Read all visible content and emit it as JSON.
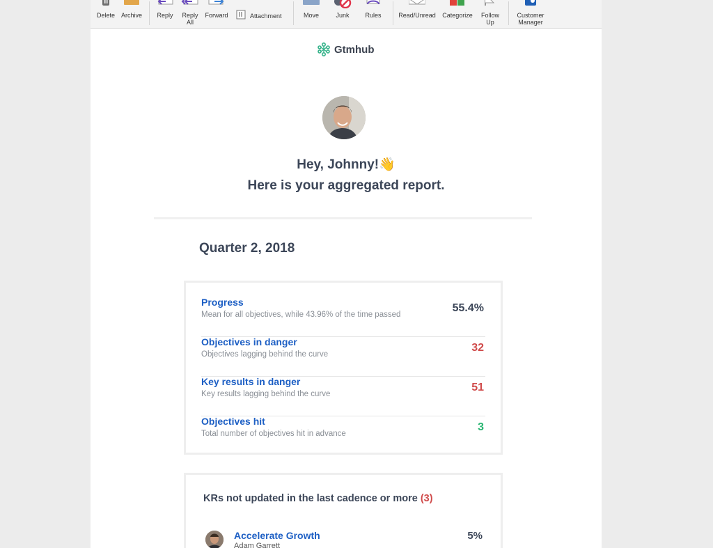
{
  "toolbar": {
    "buttons": [
      {
        "label": "Delete"
      },
      {
        "label": "Archive"
      },
      {
        "label": "Reply"
      },
      {
        "label": "Reply All"
      },
      {
        "label": "Forward"
      },
      {
        "label": "Attachment"
      },
      {
        "label": "Move"
      },
      {
        "label": "Junk"
      },
      {
        "label": "Rules"
      },
      {
        "label": "Read/Unread"
      },
      {
        "label": "Categorize"
      },
      {
        "label": "Follow Up"
      },
      {
        "label": "Customer Manager"
      }
    ]
  },
  "email": {
    "brand": "Gtmhub",
    "greeting": "Hey, Johnny!👋",
    "subtitle": "Here is your aggregated report.",
    "quarter": "Quarter 2, 2018",
    "metrics": [
      {
        "title": "Progress",
        "desc": "Mean for all objectives, while 43.96% of the time passed",
        "value": "55.4%",
        "color": "#3c4658"
      },
      {
        "title": "Objectives in danger",
        "desc": "Objectives lagging behind the curve",
        "value": "32",
        "color": "#d04b4b"
      },
      {
        "title": "Key results in danger",
        "desc": "Key results lagging behind the curve",
        "value": "51",
        "color": "#d04b4b"
      },
      {
        "title": "Objectives hit",
        "desc": "Total number of objectives hit in advance",
        "value": "3",
        "color": "#2bb673"
      }
    ],
    "kr_section": {
      "title": "KRs not updated in the last cadence or more",
      "count": "(3)",
      "items": [
        {
          "name": "Accelerate Growth",
          "owner": "Adam Garrett",
          "value": "5%"
        }
      ]
    }
  },
  "colors": {
    "brand": "#35b38a",
    "link": "#1d5fc4",
    "danger": "#d04b4b",
    "success": "#2bb673"
  }
}
